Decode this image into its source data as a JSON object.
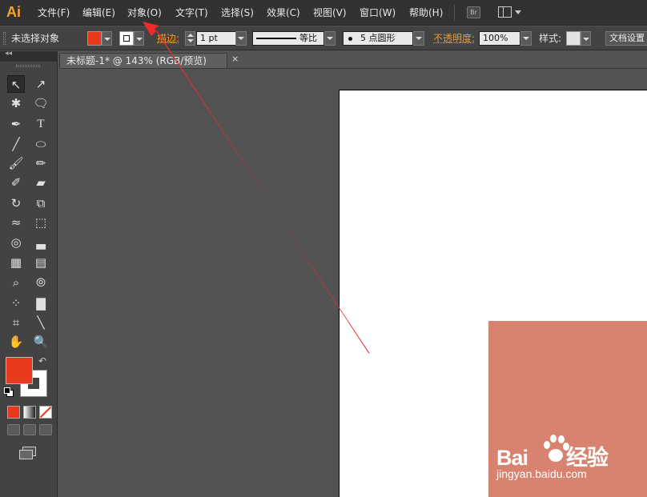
{
  "app": {
    "logo": "Ai"
  },
  "menu": {
    "items": [
      "文件(F)",
      "编辑(E)",
      "对象(O)",
      "文字(T)",
      "选择(S)",
      "效果(C)",
      "视图(V)",
      "窗口(W)",
      "帮助(H)"
    ],
    "bridge_label": "Br"
  },
  "control_bar": {
    "selection_status": "未选择对象",
    "fill_color": "#e8391c",
    "stroke_label": "描边:",
    "stroke_weight": "1 pt",
    "variable_width_label": "等比",
    "brush_label": "5 点圆形",
    "opacity_label": "不透明度:",
    "opacity_value": "100%",
    "style_label": "样式:",
    "doc_setup": "文档设置"
  },
  "document": {
    "tab_title": "未标题-1* @ 143% (RGB/预览)",
    "close_glyph": "×"
  },
  "toolbox": {
    "collapse_glyph": "◂◂",
    "fill_color": "#e8391c",
    "stroke_color": "#ffffff"
  },
  "canvas": {
    "rect_color": "#d88370",
    "annotation_color": "#ee2b2b"
  },
  "watermark": {
    "brand_left": "Bai",
    "brand_right": "经验",
    "url": "jingyan.baidu.com"
  }
}
